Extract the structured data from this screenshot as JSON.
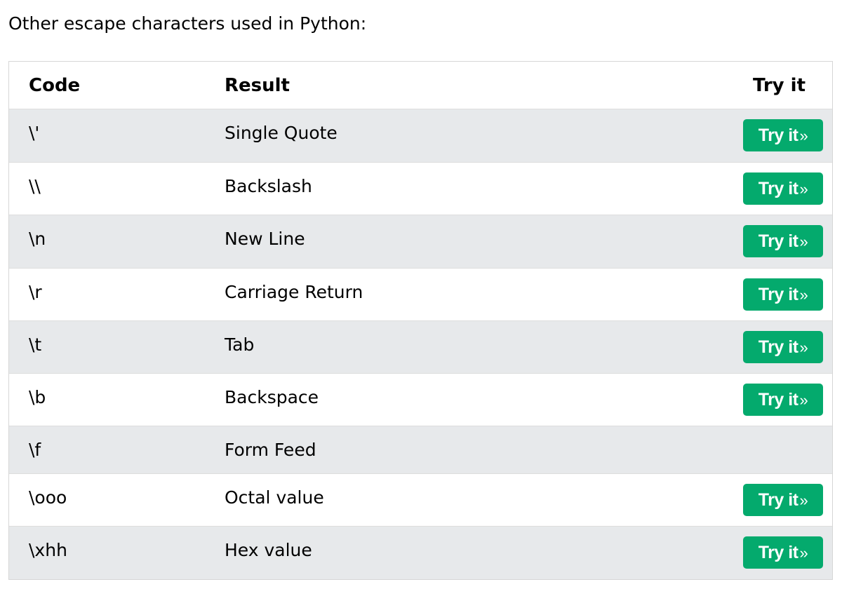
{
  "intro": "Other escape characters used in Python:",
  "table": {
    "headers": {
      "code": "Code",
      "result": "Result",
      "try": "Try it"
    },
    "button_label": "Try it",
    "button_arrow": "»",
    "button_color": "#04aa6d",
    "stripe_color": "#e7e9eb",
    "rows": [
      {
        "code": "\\'",
        "result": "Single Quote",
        "has_try": true
      },
      {
        "code": "\\\\",
        "result": "Backslash",
        "has_try": true
      },
      {
        "code": "\\n",
        "result": "New Line",
        "has_try": true
      },
      {
        "code": "\\r",
        "result": "Carriage Return",
        "has_try": true
      },
      {
        "code": "\\t",
        "result": "Tab",
        "has_try": true
      },
      {
        "code": "\\b",
        "result": "Backspace",
        "has_try": true
      },
      {
        "code": "\\f",
        "result": "Form Feed",
        "has_try": false
      },
      {
        "code": "\\ooo",
        "result": "Octal value",
        "has_try": true
      },
      {
        "code": "\\xhh",
        "result": "Hex value",
        "has_try": true
      }
    ]
  }
}
